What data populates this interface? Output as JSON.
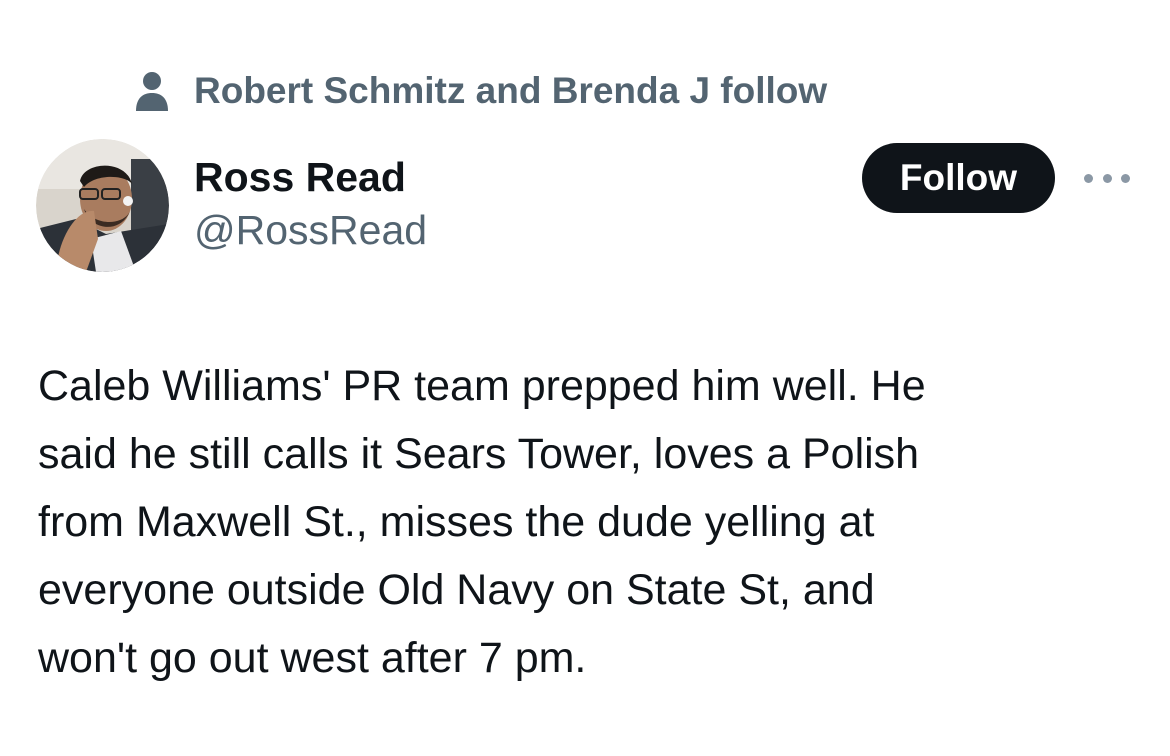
{
  "social_context": {
    "icon": "person-icon",
    "text": "Robert Schmitz and Brenda J follow"
  },
  "author": {
    "display_name": "Ross Read",
    "handle": "@RossRead",
    "avatar_alt": "Ross Read profile photo"
  },
  "actions": {
    "follow_label": "Follow",
    "more_icon": "more-horizontal-icon"
  },
  "tweet": {
    "lines": [
      "Caleb Williams' PR team prepped him well. He",
      "said he still calls it Sears Tower, loves a Polish",
      "from Maxwell St., misses the dude yelling at",
      "everyone outside Old Navy on State St, and",
      "won't go out west after 7 pm."
    ]
  },
  "colors": {
    "primary_text": "#0f1419",
    "secondary_text": "#536471",
    "button_bg": "#0f1419",
    "button_text": "#ffffff",
    "more_dots": "#8b98a5"
  }
}
